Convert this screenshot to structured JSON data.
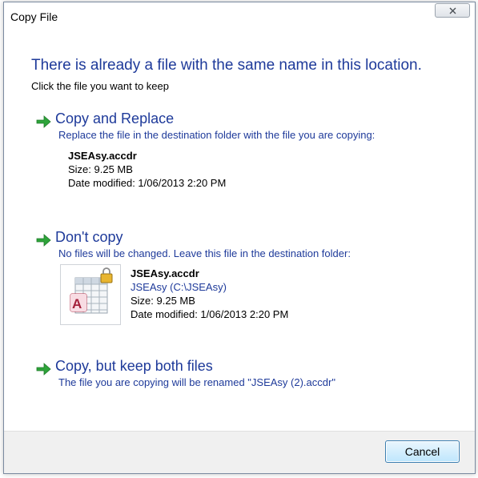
{
  "window": {
    "title": "Copy File",
    "close_icon": "close-x-icon"
  },
  "main": {
    "heading": "There is already a file with the same name in this location.",
    "subheading": "Click the file you want to keep"
  },
  "options": {
    "replace": {
      "title": "Copy and Replace",
      "description": "Replace the file in the destination folder with the file you are copying:",
      "file_name": "JSEAsy.accdr",
      "size": "Size: 9.25 MB",
      "date": "Date modified: 1/06/2013 2:20 PM",
      "icon": "green-arrow-icon"
    },
    "dont_copy": {
      "title": "Don't copy",
      "description": "No files will be changed. Leave this file in the destination folder:",
      "file_name": "JSEAsy.accdr",
      "path": "JSEAsy (C:\\JSEAsy)",
      "size": "Size: 9.25 MB",
      "date": "Date modified: 1/06/2013 2:20 PM",
      "icon": "green-arrow-icon",
      "file_icon": "access-database-locked-icon"
    },
    "keep_both": {
      "title": "Copy, but keep both files",
      "description": "The file you are copying will be renamed \"JSEAsy (2).accdr\"",
      "icon": "green-arrow-icon"
    }
  },
  "footer": {
    "cancel_label": "Cancel"
  },
  "colors": {
    "link_blue": "#1e3a9a",
    "arrow_green": "#2ea43a"
  }
}
